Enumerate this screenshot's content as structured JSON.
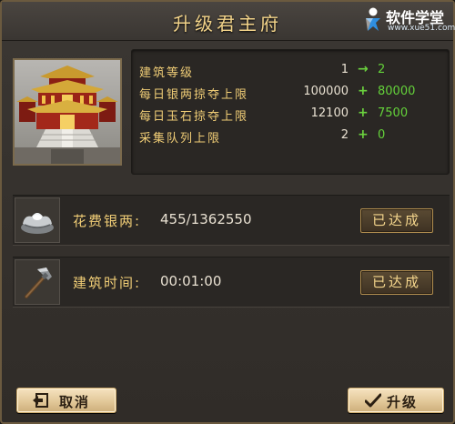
{
  "dialog": {
    "title": "升级君主府"
  },
  "watermark": {
    "name": "软件学堂",
    "url": "www.xue51.com"
  },
  "upgrade_stats": [
    {
      "label": "建筑等级",
      "current": "1",
      "op": "→",
      "next": "2"
    },
    {
      "label": "每日银两掠夺上限",
      "current": "100000",
      "op": "+",
      "next": "80000"
    },
    {
      "label": "每日玉石掠夺上限",
      "current": "12100",
      "op": "+",
      "next": "7500"
    },
    {
      "label": "采集队列上限",
      "current": "2",
      "op": "+",
      "next": "0"
    }
  ],
  "requirements": [
    {
      "label": "花费银两:",
      "value": "455/1362550",
      "status": "已达成",
      "icon": "silver-ingot-icon"
    },
    {
      "label": "建筑时间:",
      "value": "00:01:00",
      "status": "已达成",
      "icon": "hammer-icon"
    }
  ],
  "buttons": {
    "cancel_label": "取消",
    "upgrade_label": "升级"
  },
  "colors": {
    "gold_text": "#f0cd76",
    "green_value": "#64d23a",
    "frame_border": "#6b5a3f"
  }
}
